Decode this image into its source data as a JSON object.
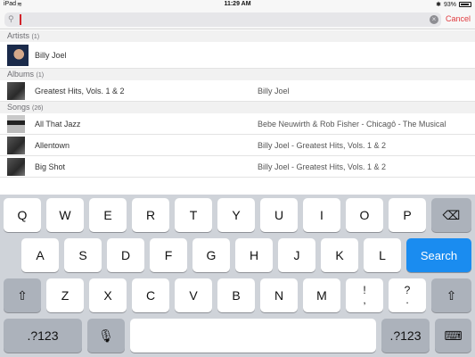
{
  "status": {
    "device": "iPad",
    "wifi_icon": "wifi-icon",
    "time": "11:29 AM",
    "bluetooth_icon": "bluetooth-icon",
    "battery": "93%"
  },
  "search": {
    "value": "",
    "clear_icon": "clear-icon",
    "cancel_label": "Cancel"
  },
  "results": {
    "artists": {
      "label": "Artists",
      "count": "(1)",
      "items": [
        {
          "title": "Billy Joel"
        }
      ]
    },
    "albums": {
      "label": "Albums",
      "count": "(1)",
      "items": [
        {
          "title": "Greatest Hits, Vols. 1 & 2",
          "subtitle": "Billy Joel"
        }
      ]
    },
    "songs": {
      "label": "Songs",
      "count": "(26)",
      "items": [
        {
          "title": "All That Jazz",
          "subtitle": "Bebe Neuwirth & Rob Fisher - Chicagô - The Musical"
        },
        {
          "title": "Allentown",
          "subtitle": "Billy Joel - Greatest Hits, Vols. 1 & 2"
        },
        {
          "title": "Big Shot",
          "subtitle": "Billy Joel - Greatest Hits, Vols. 1 & 2"
        }
      ]
    }
  },
  "keyboard": {
    "row1": [
      "Q",
      "W",
      "E",
      "R",
      "T",
      "Y",
      "U",
      "I",
      "O",
      "P"
    ],
    "row2": [
      "A",
      "S",
      "D",
      "F",
      "G",
      "H",
      "J",
      "K",
      "L"
    ],
    "row3": [
      "Z",
      "X",
      "C",
      "V",
      "B",
      "N",
      "M"
    ],
    "exclaim": {
      "top": "!",
      "bottom": ","
    },
    "question": {
      "top": "?",
      "bottom": "."
    },
    "numbers_label": ".?123",
    "search_label": "Search",
    "backspace_icon": "⌫",
    "shift_icon": "⇧",
    "mic_icon": "🎙",
    "hide_keyboard_icon": "⌨"
  }
}
